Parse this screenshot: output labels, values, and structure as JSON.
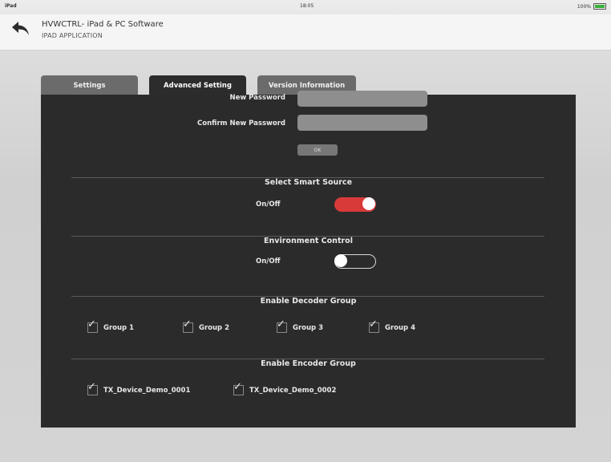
{
  "status_bar": {
    "carrier": "iPad",
    "time": "18:05",
    "battery": "100%"
  },
  "header": {
    "title": "HVWCTRL- iPad & PC Software",
    "subtitle": "IPAD APPLICATION"
  },
  "tabs": [
    {
      "label": "Settings",
      "active": false
    },
    {
      "label": "Advanced Setting",
      "active": true
    },
    {
      "label": "Version Information",
      "active": false
    }
  ],
  "password": {
    "new_label": "New Password",
    "new_value": "",
    "confirm_label": "Confirm New Password",
    "confirm_value": "",
    "ok_label": "OK"
  },
  "smart_source": {
    "title": "Select Smart Source",
    "toggle_label": "On/Off",
    "on": true
  },
  "environment": {
    "title": "Environment Control",
    "toggle_label": "On/Off",
    "on": false
  },
  "decoder_group": {
    "title": "Enable Decoder Group",
    "items": [
      {
        "label": "Group 1",
        "checked": true
      },
      {
        "label": "Group 2",
        "checked": true
      },
      {
        "label": "Group 3",
        "checked": true
      },
      {
        "label": "Group 4",
        "checked": true
      }
    ]
  },
  "encoder_group": {
    "title": "Enable Encoder Group",
    "items": [
      {
        "label": "TX_Device_Demo_0001",
        "checked": true
      },
      {
        "label": "TX_Device_Demo_0002",
        "checked": true
      }
    ]
  },
  "colors": {
    "toggle_on": "#d83a3a",
    "panel": "#2b2b2b",
    "battery": "#3ab03a"
  }
}
